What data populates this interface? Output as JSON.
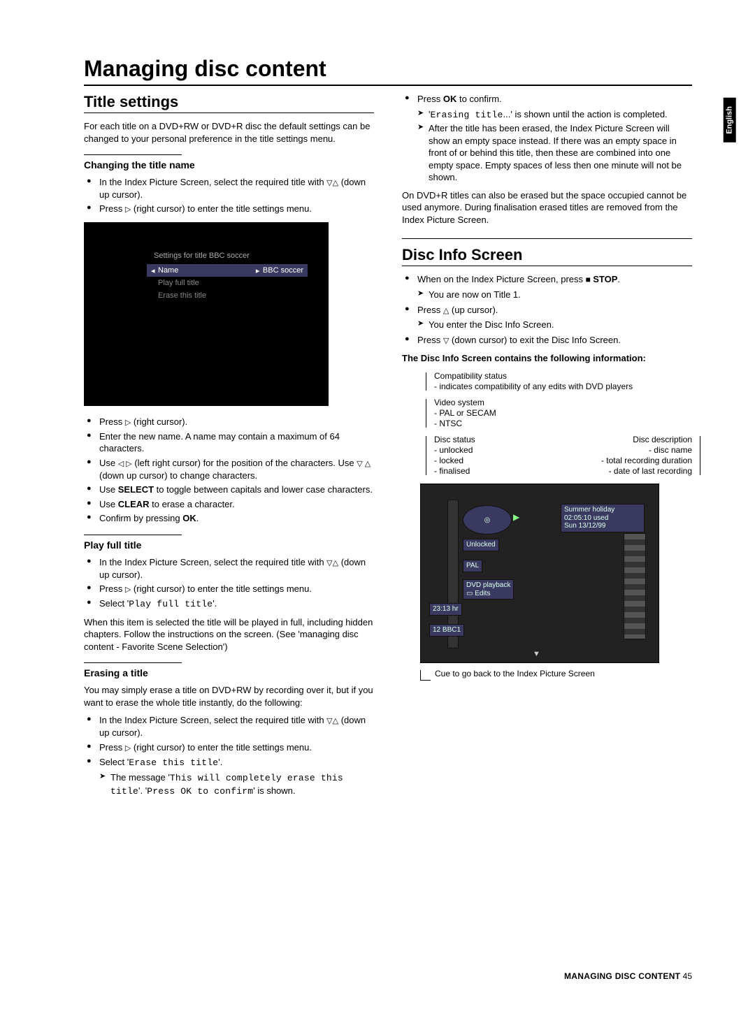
{
  "lang_tab": "English",
  "page_title": "Managing disc content",
  "footer": {
    "label": "MANAGING DISC CONTENT",
    "page": "45"
  },
  "left": {
    "title_settings_h": "Title settings",
    "title_settings_intro": "For each title on a DVD+RW or DVD+R disc the default settings can be changed to your personal preference in the title settings menu.",
    "changing_title_h": "Changing the title name",
    "changing_b1a": "In the Index Picture Screen, select the required title with ",
    "changing_b1b": " (down up cursor).",
    "changing_b2a": "Press ",
    "changing_b2b": " (right cursor) to enter the title settings menu.",
    "screen1": {
      "header": "Settings for title BBC soccer",
      "row_name": "Name",
      "row_name_val": "BBC soccer",
      "row_play": "Play full title",
      "row_erase": "Erase this title"
    },
    "after_screen_b1a": "Press ",
    "after_screen_b1b": "  (right cursor).",
    "after_screen_b2": "Enter the new name. A name may contain a maximum of 64 characters.",
    "after_screen_b3a": "Use ",
    "after_screen_b3b": " (left right cursor) for the position of the characters. Use ",
    "after_screen_b3c": " (down up cursor) to change characters.",
    "after_screen_b4a": "Use ",
    "after_screen_b4_bold": "SELECT",
    "after_screen_b4b": " to toggle between capitals and lower case characters.",
    "after_screen_b5a": "Use ",
    "after_screen_b5_bold": "CLEAR",
    "after_screen_b5b": " to erase a character.",
    "after_screen_b6a": "Confirm by pressing ",
    "after_screen_b6_bold": "OK",
    "after_screen_b6b": ".",
    "play_full_h": "Play full title",
    "play_b1a": "In the Index Picture Screen, select the required title with ",
    "play_b1b": " (down up cursor).",
    "play_b2a": "Press ",
    "play_b2b": " (right cursor) to enter the title settings menu.",
    "play_b3a": "Select '",
    "play_b3_osd": "Play full title",
    "play_b3b": "'.",
    "play_after": "When this item is selected the title will be played in full, including hidden chapters. Follow the instructions on the screen. (See 'managing disc content - Favorite Scene Selection')",
    "erase_h": "Erasing a title",
    "erase_intro": "You may simply erase a title on DVD+RW by recording over it, but if you want to erase the whole title instantly, do the following:",
    "erase_b1a": "In the Index Picture Screen, select the required title with ",
    "erase_b1b": " (down up cursor).",
    "erase_b2a": "Press ",
    "erase_b2b": " (right cursor) to enter the title settings menu.",
    "erase_b3a": "Select '",
    "erase_b3_osd": "Erase this title",
    "erase_b3b": "'.",
    "erase_arrow_a": "The message '",
    "erase_arrow_osd1": "This will completely erase this title",
    "erase_arrow_mid": "'. '",
    "erase_arrow_osd2": "Press OK to confirm",
    "erase_arrow_b": "' is shown."
  },
  "right": {
    "top_b1a": "Press ",
    "top_b1_bold": "OK",
    "top_b1b": " to confirm.",
    "top_arrow1a": "'",
    "top_arrow1_osd": "Erasing title",
    "top_arrow1b": "...' is shown until the action is completed.",
    "top_arrow2": "After the title has been erased, the Index Picture Screen will show an empty space instead. If there was an empty space in front of or behind this title, then these are combined into one empty space. Empty spaces of less then one minute will not be shown.",
    "top_para": "On DVD+R titles can also be erased but the space occupied cannot be used anymore. During finalisation erased titles are removed from the Index Picture Screen.",
    "disc_info_h": "Disc Info Screen",
    "di_b1a": "When on the Index Picture Screen, press ",
    "di_b1_bold": "STOP",
    "di_b1b": ".",
    "di_arrow1": "You are now on Title 1.",
    "di_b2a": "Press ",
    "di_b2b": " (up cursor).",
    "di_arrow2": "You enter the Disc Info Screen.",
    "di_b3a": "Press ",
    "di_b3b": " (down cursor) to exit the Disc Info Screen.",
    "di_contains": "The Disc Info Screen contains the following information:",
    "lbl_compat_t": "Compatibility status",
    "lbl_compat_1": "- indicates compatibility of any edits with DVD players",
    "lbl_video_t": "Video system",
    "lbl_video_1": "- PAL or SECAM",
    "lbl_video_2": "- NTSC",
    "lbl_status_t": "Disc status",
    "lbl_status_1": "- unlocked",
    "lbl_status_2": "- locked",
    "lbl_status_3": "- finalised",
    "lbl_desc_t": "Disc description",
    "lbl_desc_1": "- disc name",
    "lbl_desc_2": "- total recording duration",
    "lbl_desc_3": "- date of last recording",
    "screen2": {
      "desc_l1": "Summer holiday",
      "desc_l2": "02:05:10 used",
      "desc_l3": "Sun 13/12/99",
      "status": "Unlocked",
      "vsys": "PAL",
      "compat1": "DVD playback",
      "compat2": "▭ Edits",
      "time": "23:13 hr",
      "ch": "12 BBC1"
    },
    "cue_text": "Cue to go back to the Index Picture Screen"
  }
}
